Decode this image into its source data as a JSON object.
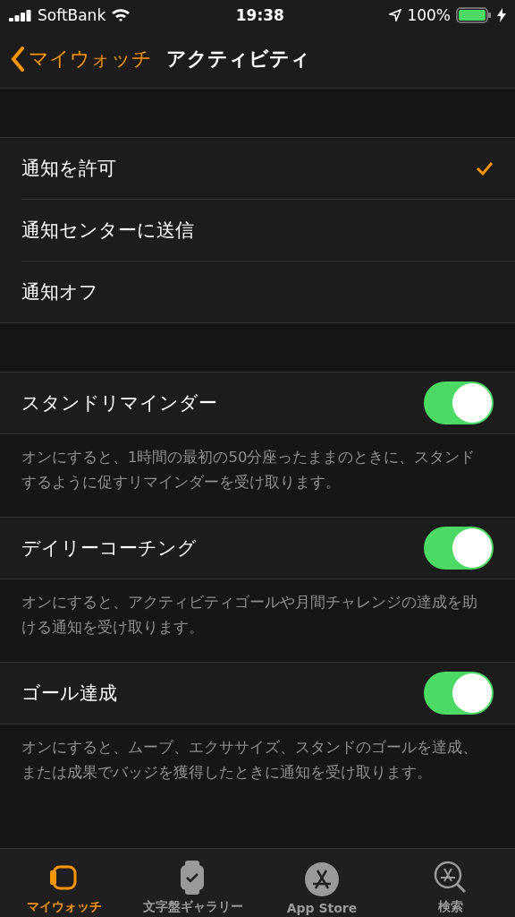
{
  "status_bar": {
    "carrier": "SoftBank",
    "time": "19:38",
    "battery": "100%"
  },
  "nav": {
    "back": "マイウォッチ",
    "title": "アクティビティ"
  },
  "notification_options": [
    {
      "label": "通知を許可",
      "selected": true
    },
    {
      "label": "通知センターに送信",
      "selected": false
    },
    {
      "label": "通知オフ",
      "selected": false
    }
  ],
  "toggles": [
    {
      "label": "スタンドリマインダー",
      "on": true,
      "footer": "オンにすると、1時間の最初の50分座ったままのときに、スタンドするように促すリマインダーを受け取ります。"
    },
    {
      "label": "デイリーコーチング",
      "on": true,
      "footer": "オンにすると、アクティビティゴールや月間チャレンジの達成を助ける通知を受け取ります。"
    },
    {
      "label": "ゴール達成",
      "on": true,
      "footer": "オンにすると、ムーブ、エクササイズ、スタンドのゴールを達成、または成果でバッジを獲得したときに通知を受け取ります。"
    }
  ],
  "tab_bar": [
    {
      "label": "マイウォッチ",
      "kind": "watch",
      "selected": true
    },
    {
      "label": "文字盤ギャラリー",
      "kind": "face",
      "selected": false
    },
    {
      "label": "App Store",
      "kind": "store",
      "selected": false
    },
    {
      "label": "検索",
      "kind": "search",
      "selected": false
    }
  ]
}
